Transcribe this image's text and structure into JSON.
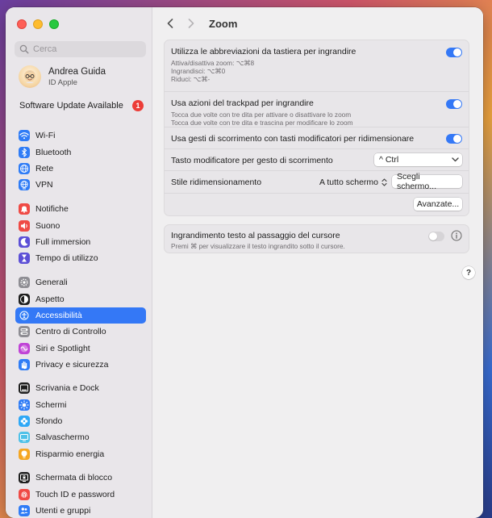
{
  "sidebar": {
    "search_placeholder": "Cerca",
    "account": {
      "name": "Andrea Guida",
      "subtitle": "ID Apple"
    },
    "software_update": {
      "label": "Software Update Available",
      "count": "1"
    },
    "groups": [
      [
        {
          "label": "Wi-Fi",
          "icon": "wifi-icon",
          "color": "#2f7cf6"
        },
        {
          "label": "Bluetooth",
          "icon": "bluetooth-icon",
          "color": "#2f7cf6"
        },
        {
          "label": "Rete",
          "icon": "globe-icon",
          "color": "#2f7cf6"
        },
        {
          "label": "VPN",
          "icon": "vpn-globe-icon",
          "color": "#2f7cf6"
        }
      ],
      [
        {
          "label": "Notifiche",
          "icon": "bell-icon",
          "color": "#ef4a45"
        },
        {
          "label": "Suono",
          "icon": "speaker-icon",
          "color": "#ef4a45"
        },
        {
          "label": "Full immersion",
          "icon": "moon-icon",
          "color": "#5c4fd6"
        },
        {
          "label": "Tempo di utilizzo",
          "icon": "hourglass-icon",
          "color": "#5c4fd6"
        }
      ],
      [
        {
          "label": "Generali",
          "icon": "gear-icon",
          "color": "#8e8d93"
        },
        {
          "label": "Aspetto",
          "icon": "appearance-icon",
          "color": "#1e1e1e"
        },
        {
          "label": "Accessibilità",
          "icon": "accessibility-icon",
          "color": "#2f7cf6",
          "active": true
        },
        {
          "label": "Centro di Controllo",
          "icon": "control-center-icon",
          "color": "#8e8d93"
        },
        {
          "label": "Siri e Spotlight",
          "icon": "siri-icon",
          "color": "#c043d6"
        },
        {
          "label": "Privacy e sicurezza",
          "icon": "hand-icon",
          "color": "#2f7cf6"
        }
      ],
      [
        {
          "label": "Scrivania e Dock",
          "icon": "dock-icon",
          "color": "#1e1e1e"
        },
        {
          "label": "Schermi",
          "icon": "sun-icon",
          "color": "#2f7cf6"
        },
        {
          "label": "Sfondo",
          "icon": "flower-icon",
          "color": "#2fa8f6"
        },
        {
          "label": "Salvaschermo",
          "icon": "screensaver-icon",
          "color": "#4fc1e8"
        },
        {
          "label": "Risparmio energia",
          "icon": "bulb-icon",
          "color": "#f5a623"
        }
      ],
      [
        {
          "label": "Schermata di blocco",
          "icon": "lock-screen-icon",
          "color": "#1e1e1e"
        },
        {
          "label": "Touch ID e password",
          "icon": "fingerprint-icon",
          "color": "#ef4a45"
        },
        {
          "label": "Utenti e gruppi",
          "icon": "users-icon",
          "color": "#2f7cf6"
        }
      ]
    ]
  },
  "main": {
    "title": "Zoom",
    "rows": {
      "keyboard": {
        "title": "Utilizza le abbreviazioni da tastiera per ingrandire",
        "lines": [
          "Attiva/disattiva zoom: ⌥⌘8",
          "Ingrandisci: ⌥⌘0",
          "Riduci: ⌥⌘-"
        ]
      },
      "trackpad": {
        "title": "Usa azioni del trackpad per ingrandire",
        "lines": [
          "Tocca due volte con tre dita per attivare o disattivare lo zoom",
          "Tocca due volte con tre dita e trascina per modificare lo zoom"
        ]
      },
      "scroll": {
        "title": "Usa gesti di scorrimento con tasti modificatori per ridimensionare"
      },
      "modifier": {
        "title": "Tasto modificatore per gesto di scorrimento",
        "value": "^ Ctrl"
      },
      "style": {
        "title": "Stile ridimensionamento",
        "value": "A tutto schermo",
        "button": "Scegli schermo..."
      },
      "advanced": {
        "button": "Avanzate..."
      }
    },
    "hover_text": {
      "title": "Ingrandimento testo al passaggio del cursore",
      "subtitle": "Premi ⌘ per visualizzare il testo ingrandito sotto il cursore."
    },
    "help": "?"
  }
}
